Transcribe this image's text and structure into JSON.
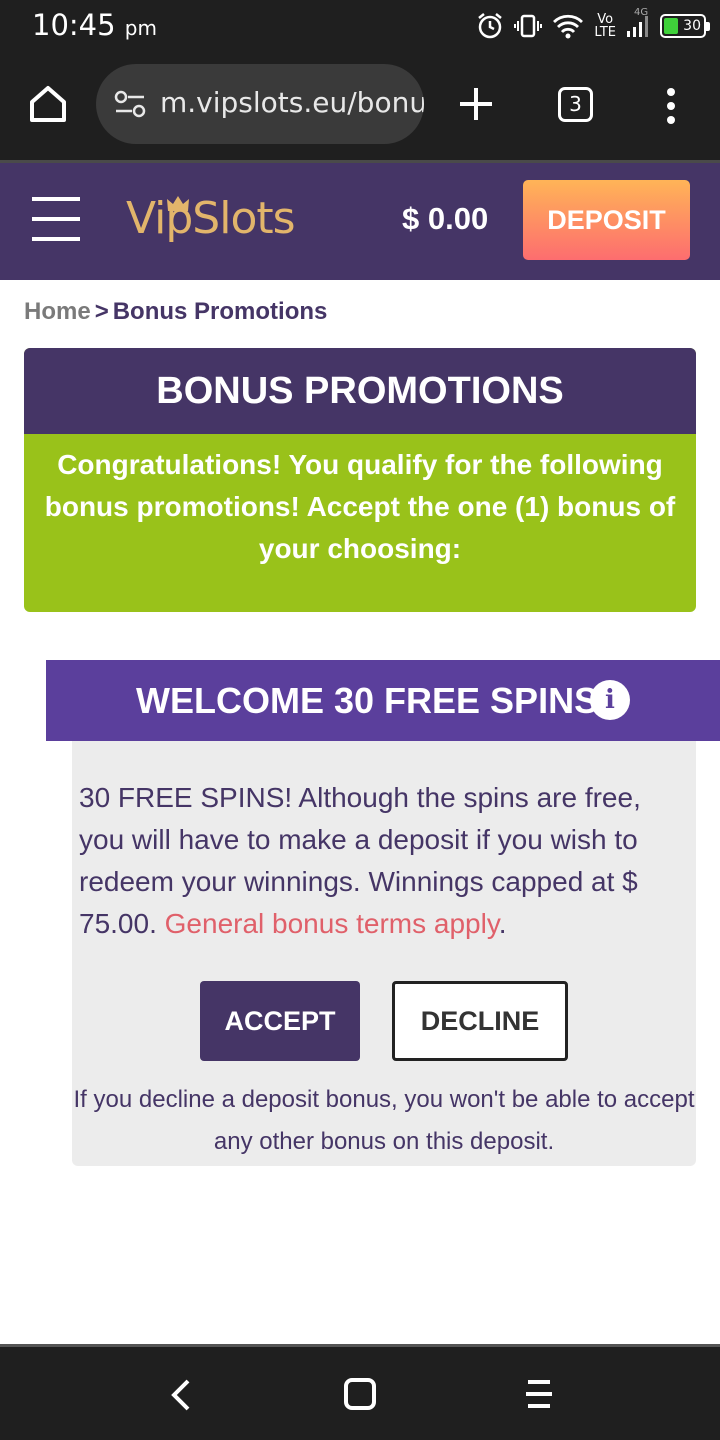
{
  "status_bar": {
    "time": "10:45",
    "ampm": "pm",
    "network_top": "Vo",
    "network_bottom": "LTE",
    "network_gen": "4G",
    "battery_level": "30",
    "icons": [
      "alarm-icon",
      "vibrate-icon",
      "wifi-icon",
      "signal-icon",
      "battery-charging-icon"
    ]
  },
  "browser": {
    "url": "m.vipslots.eu/bonus",
    "tab_count": "3",
    "icons": [
      "home-icon",
      "site-settings-icon",
      "new-tab-icon",
      "tab-switcher-icon",
      "menu-icon"
    ]
  },
  "site_header": {
    "logo_text": "VipSlots",
    "balance": "$ 0.00",
    "deposit_label": "DEPOSIT",
    "colors": {
      "header_bg": "#453566",
      "logo": "#e2b56b",
      "deposit_top": "#ffb457",
      "deposit_bottom": "#fd6d6f"
    }
  },
  "breadcrumb": {
    "home": "Home",
    "separator": ">",
    "current": "Bonus Promotions"
  },
  "promotions": {
    "title": "BONUS PROMOTIONS",
    "message": "Congratulations! You qualify for the following bonus promotions! Accept the one (1) bonus of your choosing:",
    "colors": {
      "title_bg": "#453566",
      "message_bg": "#99c21a"
    }
  },
  "offer": {
    "title": "WELCOME 30 FREE SPINS",
    "info_symbol": "i",
    "description": "30 FREE SPINS! Although the spins are free, you will have to make a deposit if you wish to redeem your winnings. Winnings capped at $ 75.00.",
    "terms_link": "General bonus terms apply",
    "terms_suffix": ".",
    "accept_label": "ACCEPT",
    "decline_label": "DECLINE",
    "note": "If you decline a deposit bonus, you won't be able to accept any other bonus on this deposit.",
    "colors": {
      "head_bg": "#5b3f9c",
      "body_bg": "#ececec",
      "link": "#e0606a"
    }
  },
  "nav_bar": {
    "icons": [
      "back-icon",
      "home-icon",
      "recents-icon"
    ]
  }
}
